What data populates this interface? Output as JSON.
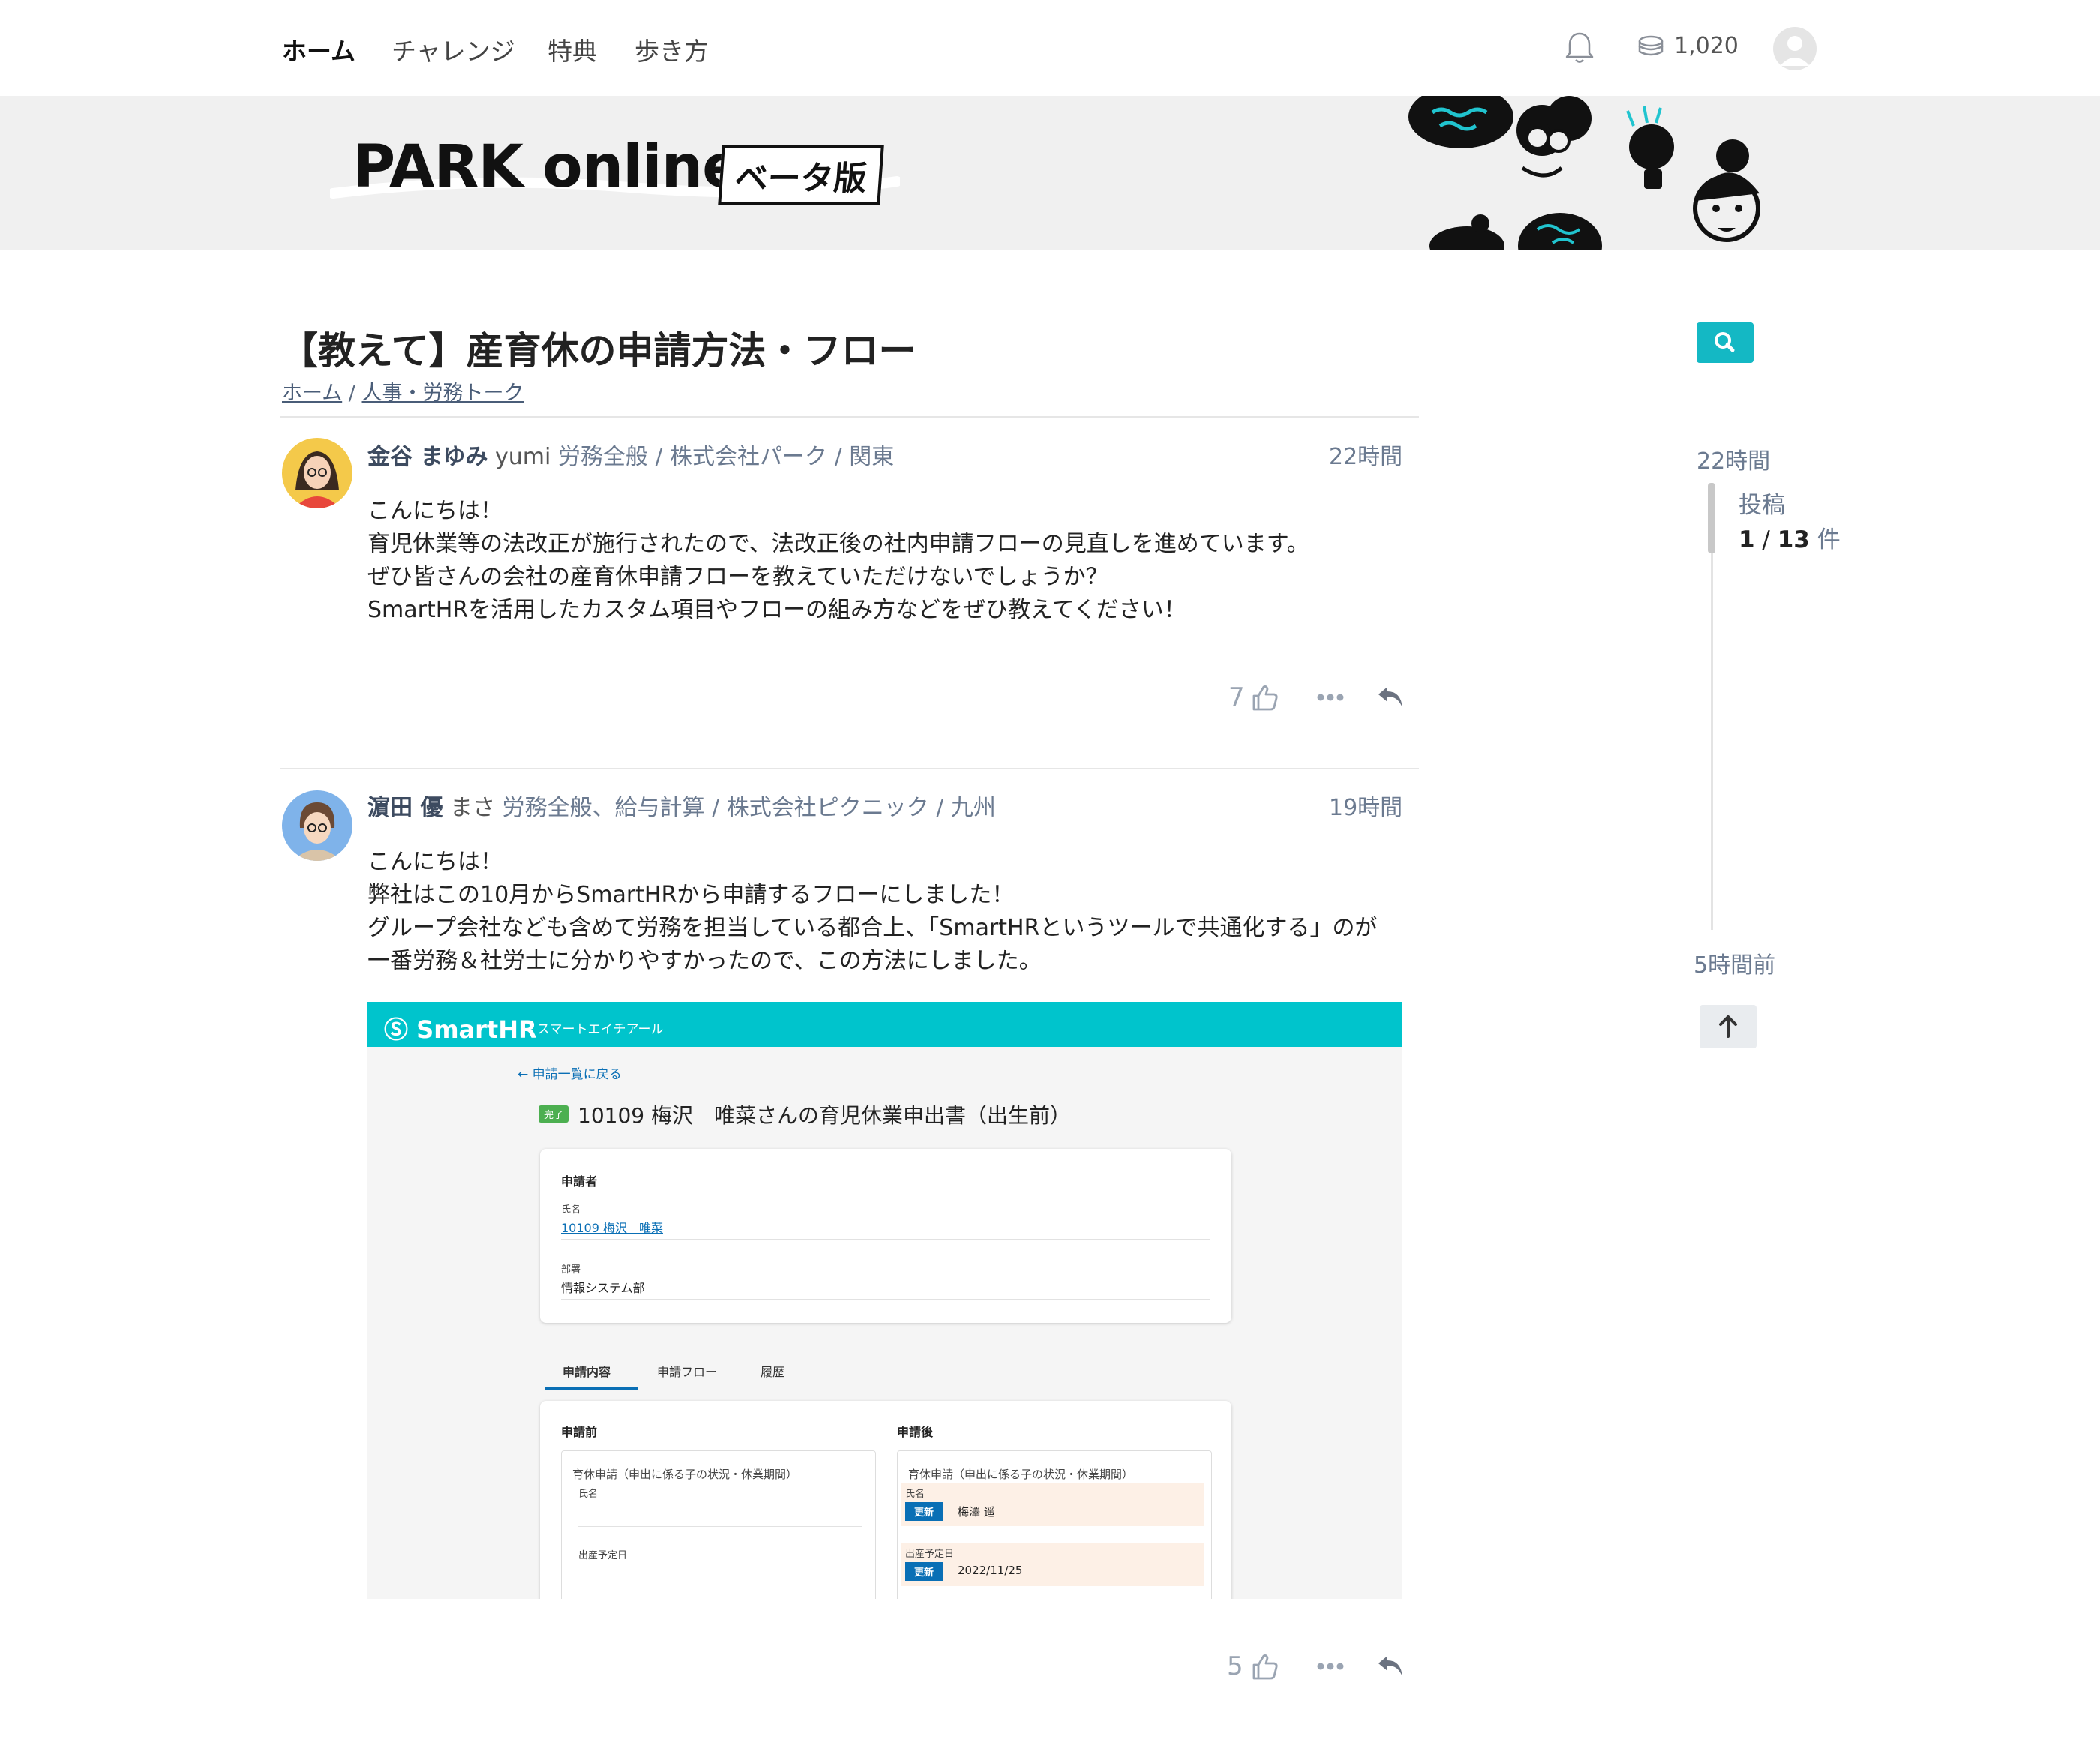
{
  "nav": {
    "items": [
      "ホーム",
      "チャレンジ",
      "特典",
      "歩き方"
    ],
    "points": "1,020"
  },
  "banner": {
    "logo": "PARK online",
    "badge": "ベータ版"
  },
  "topic": {
    "title": "【教えて】産育休の申請方法・フロー",
    "breadcrumb": [
      "ホーム",
      "人事・労務トーク"
    ],
    "breadcrumb_sep": "/"
  },
  "posts": [
    {
      "name": "金谷 まゆみ",
      "nick": "yumi",
      "meta": "労務全般 / 株式会社パーク / 関東",
      "time": "22時間",
      "lines": [
        "こんにちは！",
        "育児休業等の法改正が施行されたので、法改正後の社内申請フローの見直しを進めています。",
        "ぜひ皆さんの会社の産育休申請フローを教えていただけないでしょうか？",
        "SmartHRを活用したカスタム項目やフローの組み方などをぜひ教えてください！"
      ],
      "likes": "7"
    },
    {
      "name": "濵田 優",
      "nick": "まさ",
      "meta": "労務全般、給与計算 / 株式会社ピクニック / 九州",
      "time": "19時間",
      "lines": [
        "こんにちは！",
        "弊社はこの10月からSmartHRから申請するフローにしました！",
        "グループ会社なども含めて労務を担当している都合上、「SmartHRというツールで共通化する」のが",
        "一番労務＆社労士に分かりやすかったので、この方法にしました。"
      ],
      "likes": "5"
    }
  ],
  "screenshot": {
    "logo": "SmartHR",
    "logo_sub": "スマートエイチアール",
    "back": "申請一覧に戻る",
    "status": "完了",
    "request_title": "10109 梅沢　唯菜さんの育児休業申出書（出生前）",
    "applicant_heading": "申請者",
    "name_label": "氏名",
    "name_value": "10109 梅沢　唯菜",
    "dept_label": "部署",
    "dept_value": "情報システム部",
    "tabs": [
      "申請内容",
      "申請フロー",
      "履歴"
    ],
    "before_heading": "申請前",
    "after_heading": "申請後",
    "section_title": "育休申請（申出に係る子の状況・休業期間）",
    "field_name": "氏名",
    "field_due": "出産予定日",
    "update_label": "更新",
    "after_name": "梅澤 遥",
    "after_due": "2022/11/25"
  },
  "timeline": {
    "top": "22時間",
    "label": "投稿",
    "current": "1",
    "sep": " / ",
    "total": "13",
    "unit": "件",
    "bottom": "5時間前"
  },
  "colors": {
    "accent": "#14b8c4",
    "smarthr": "#00c4cc",
    "link": "#0a6fb5"
  },
  "icons": [
    "bell-icon",
    "coin-icon",
    "search-icon",
    "like-icon",
    "more-icon",
    "reply-icon",
    "arrow-up-icon"
  ]
}
